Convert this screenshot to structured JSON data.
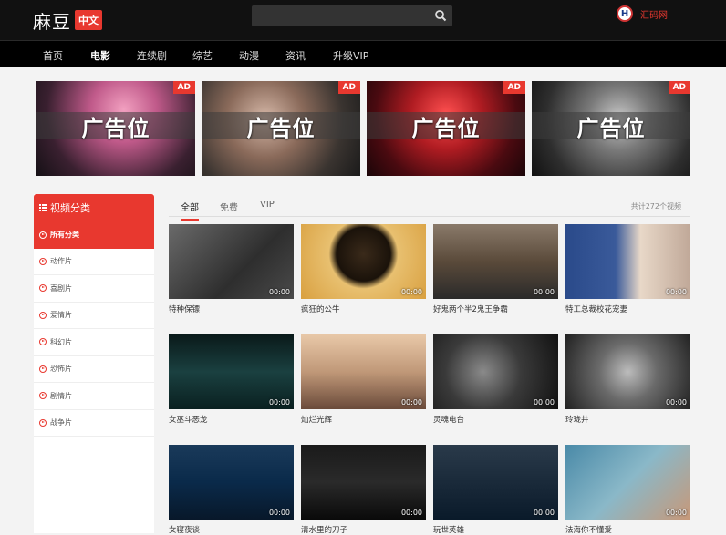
{
  "header": {
    "logo_text": "麻豆",
    "logo_badge": "中文",
    "search_placeholder": "",
    "site_name": "汇码网",
    "site_badge": "H"
  },
  "nav": [
    "首页",
    "电影",
    "连续剧",
    "综艺",
    "动漫",
    "资讯",
    "升级VIP"
  ],
  "nav_active": "电影",
  "ads": [
    {
      "text": "广告位",
      "tag": "AD"
    },
    {
      "text": "广告位",
      "tag": "AD"
    },
    {
      "text": "广告位",
      "tag": "AD"
    },
    {
      "text": "广告位",
      "tag": "AD"
    }
  ],
  "sidebar": {
    "title": "视频分类",
    "items": [
      "所有分类",
      "动作片",
      "喜剧片",
      "爱情片",
      "科幻片",
      "恐怖片",
      "剧情片",
      "战争片"
    ]
  },
  "tabs": [
    "全部",
    "免费",
    "VIP"
  ],
  "count_text": "共计272个视频",
  "videos": [
    {
      "title": "特种保镖",
      "duration": "00:00"
    },
    {
      "title": "疯狂的公牛",
      "duration": "00:00"
    },
    {
      "title": "好鬼两个半2鬼王争霸",
      "duration": "00:00"
    },
    {
      "title": "特工总裁校花宠妻",
      "duration": "00:00"
    },
    {
      "title": "女巫斗恶龙",
      "duration": "00:00"
    },
    {
      "title": "灿烂光辉",
      "duration": "00:00"
    },
    {
      "title": "灵魂电台",
      "duration": "00:00"
    },
    {
      "title": "玲珑井",
      "duration": "00:00"
    },
    {
      "title": "女寝夜谈",
      "duration": "00:00"
    },
    {
      "title": "清水里的刀子",
      "duration": "00:00"
    },
    {
      "title": "玩世英雄",
      "duration": "00:00"
    },
    {
      "title": "法海你不懂爱",
      "duration": "00:00"
    }
  ],
  "colors": {
    "accent": "#e8382f",
    "topbar": "#111111",
    "navbar": "#000000"
  }
}
